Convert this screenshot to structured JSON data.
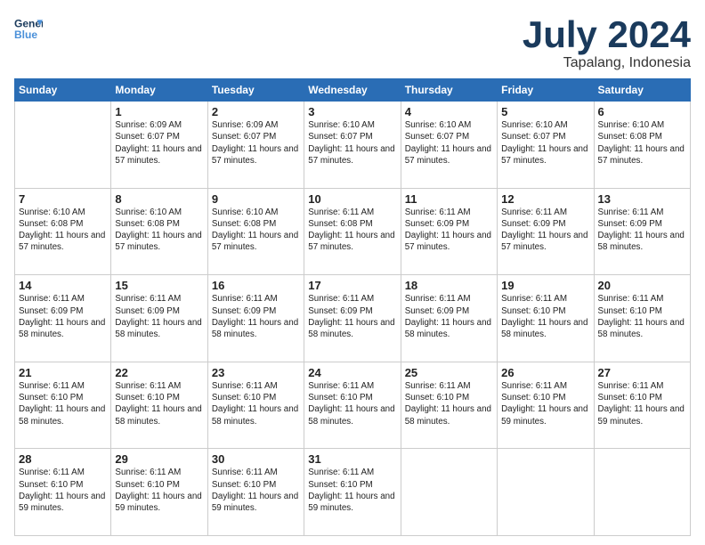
{
  "header": {
    "logo_line1": "General",
    "logo_line2": "Blue",
    "month": "July 2024",
    "location": "Tapalang, Indonesia"
  },
  "days_of_week": [
    "Sunday",
    "Monday",
    "Tuesday",
    "Wednesday",
    "Thursday",
    "Friday",
    "Saturday"
  ],
  "weeks": [
    [
      {
        "day": "",
        "empty": true
      },
      {
        "day": "1",
        "sunrise": "Sunrise: 6:09 AM",
        "sunset": "Sunset: 6:07 PM",
        "daylight": "Daylight: 11 hours and 57 minutes."
      },
      {
        "day": "2",
        "sunrise": "Sunrise: 6:09 AM",
        "sunset": "Sunset: 6:07 PM",
        "daylight": "Daylight: 11 hours and 57 minutes."
      },
      {
        "day": "3",
        "sunrise": "Sunrise: 6:10 AM",
        "sunset": "Sunset: 6:07 PM",
        "daylight": "Daylight: 11 hours and 57 minutes."
      },
      {
        "day": "4",
        "sunrise": "Sunrise: 6:10 AM",
        "sunset": "Sunset: 6:07 PM",
        "daylight": "Daylight: 11 hours and 57 minutes."
      },
      {
        "day": "5",
        "sunrise": "Sunrise: 6:10 AM",
        "sunset": "Sunset: 6:07 PM",
        "daylight": "Daylight: 11 hours and 57 minutes."
      },
      {
        "day": "6",
        "sunrise": "Sunrise: 6:10 AM",
        "sunset": "Sunset: 6:08 PM",
        "daylight": "Daylight: 11 hours and 57 minutes."
      }
    ],
    [
      {
        "day": "7",
        "sunrise": "Sunrise: 6:10 AM",
        "sunset": "Sunset: 6:08 PM",
        "daylight": "Daylight: 11 hours and 57 minutes."
      },
      {
        "day": "8",
        "sunrise": "Sunrise: 6:10 AM",
        "sunset": "Sunset: 6:08 PM",
        "daylight": "Daylight: 11 hours and 57 minutes."
      },
      {
        "day": "9",
        "sunrise": "Sunrise: 6:10 AM",
        "sunset": "Sunset: 6:08 PM",
        "daylight": "Daylight: 11 hours and 57 minutes."
      },
      {
        "day": "10",
        "sunrise": "Sunrise: 6:11 AM",
        "sunset": "Sunset: 6:08 PM",
        "daylight": "Daylight: 11 hours and 57 minutes."
      },
      {
        "day": "11",
        "sunrise": "Sunrise: 6:11 AM",
        "sunset": "Sunset: 6:09 PM",
        "daylight": "Daylight: 11 hours and 57 minutes."
      },
      {
        "day": "12",
        "sunrise": "Sunrise: 6:11 AM",
        "sunset": "Sunset: 6:09 PM",
        "daylight": "Daylight: 11 hours and 57 minutes."
      },
      {
        "day": "13",
        "sunrise": "Sunrise: 6:11 AM",
        "sunset": "Sunset: 6:09 PM",
        "daylight": "Daylight: 11 hours and 58 minutes."
      }
    ],
    [
      {
        "day": "14",
        "sunrise": "Sunrise: 6:11 AM",
        "sunset": "Sunset: 6:09 PM",
        "daylight": "Daylight: 11 hours and 58 minutes."
      },
      {
        "day": "15",
        "sunrise": "Sunrise: 6:11 AM",
        "sunset": "Sunset: 6:09 PM",
        "daylight": "Daylight: 11 hours and 58 minutes."
      },
      {
        "day": "16",
        "sunrise": "Sunrise: 6:11 AM",
        "sunset": "Sunset: 6:09 PM",
        "daylight": "Daylight: 11 hours and 58 minutes."
      },
      {
        "day": "17",
        "sunrise": "Sunrise: 6:11 AM",
        "sunset": "Sunset: 6:09 PM",
        "daylight": "Daylight: 11 hours and 58 minutes."
      },
      {
        "day": "18",
        "sunrise": "Sunrise: 6:11 AM",
        "sunset": "Sunset: 6:09 PM",
        "daylight": "Daylight: 11 hours and 58 minutes."
      },
      {
        "day": "19",
        "sunrise": "Sunrise: 6:11 AM",
        "sunset": "Sunset: 6:10 PM",
        "daylight": "Daylight: 11 hours and 58 minutes."
      },
      {
        "day": "20",
        "sunrise": "Sunrise: 6:11 AM",
        "sunset": "Sunset: 6:10 PM",
        "daylight": "Daylight: 11 hours and 58 minutes."
      }
    ],
    [
      {
        "day": "21",
        "sunrise": "Sunrise: 6:11 AM",
        "sunset": "Sunset: 6:10 PM",
        "daylight": "Daylight: 11 hours and 58 minutes."
      },
      {
        "day": "22",
        "sunrise": "Sunrise: 6:11 AM",
        "sunset": "Sunset: 6:10 PM",
        "daylight": "Daylight: 11 hours and 58 minutes."
      },
      {
        "day": "23",
        "sunrise": "Sunrise: 6:11 AM",
        "sunset": "Sunset: 6:10 PM",
        "daylight": "Daylight: 11 hours and 58 minutes."
      },
      {
        "day": "24",
        "sunrise": "Sunrise: 6:11 AM",
        "sunset": "Sunset: 6:10 PM",
        "daylight": "Daylight: 11 hours and 58 minutes."
      },
      {
        "day": "25",
        "sunrise": "Sunrise: 6:11 AM",
        "sunset": "Sunset: 6:10 PM",
        "daylight": "Daylight: 11 hours and 58 minutes."
      },
      {
        "day": "26",
        "sunrise": "Sunrise: 6:11 AM",
        "sunset": "Sunset: 6:10 PM",
        "daylight": "Daylight: 11 hours and 59 minutes."
      },
      {
        "day": "27",
        "sunrise": "Sunrise: 6:11 AM",
        "sunset": "Sunset: 6:10 PM",
        "daylight": "Daylight: 11 hours and 59 minutes."
      }
    ],
    [
      {
        "day": "28",
        "sunrise": "Sunrise: 6:11 AM",
        "sunset": "Sunset: 6:10 PM",
        "daylight": "Daylight: 11 hours and 59 minutes."
      },
      {
        "day": "29",
        "sunrise": "Sunrise: 6:11 AM",
        "sunset": "Sunset: 6:10 PM",
        "daylight": "Daylight: 11 hours and 59 minutes."
      },
      {
        "day": "30",
        "sunrise": "Sunrise: 6:11 AM",
        "sunset": "Sunset: 6:10 PM",
        "daylight": "Daylight: 11 hours and 59 minutes."
      },
      {
        "day": "31",
        "sunrise": "Sunrise: 6:11 AM",
        "sunset": "Sunset: 6:10 PM",
        "daylight": "Daylight: 11 hours and 59 minutes."
      },
      {
        "day": "",
        "empty": true
      },
      {
        "day": "",
        "empty": true
      },
      {
        "day": "",
        "empty": true
      }
    ]
  ]
}
